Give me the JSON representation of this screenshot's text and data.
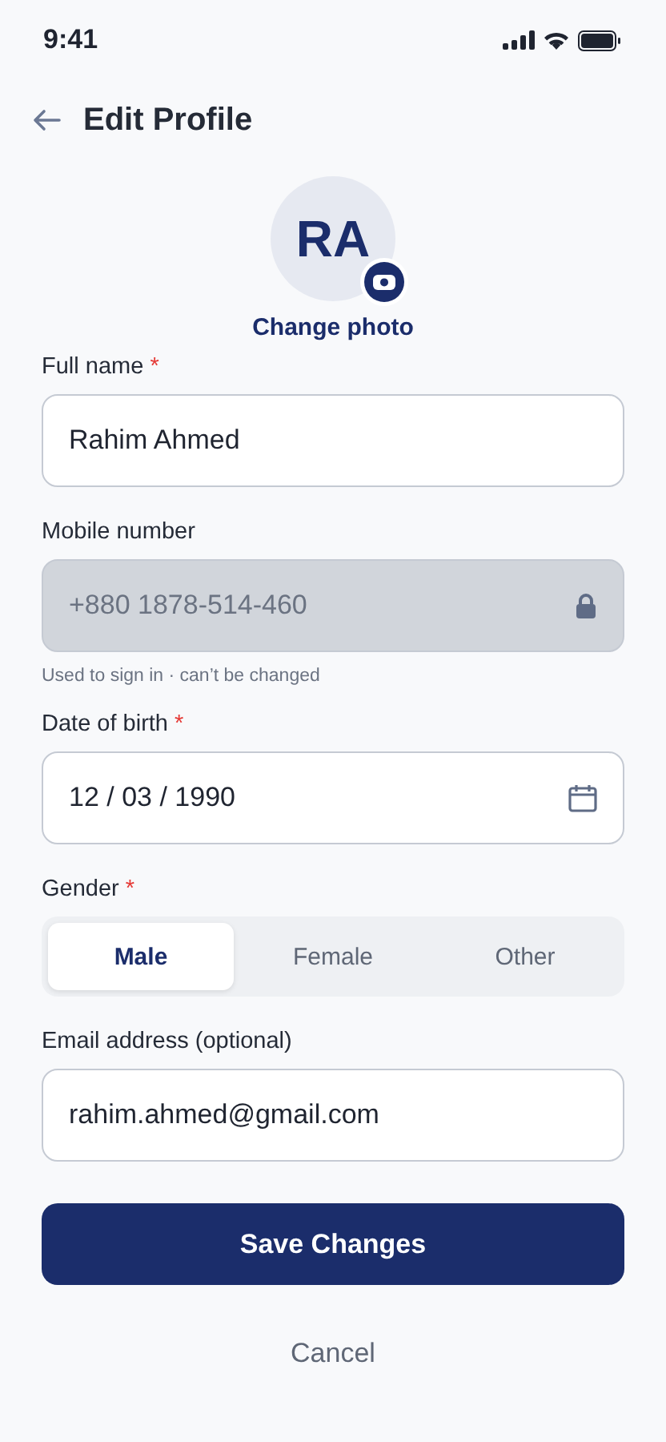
{
  "status_bar": {
    "time": "9:41"
  },
  "header": {
    "title": "Edit Profile"
  },
  "avatar": {
    "initials": "RA",
    "action": "Change photo"
  },
  "fields": [
    {
      "kind": "text",
      "label": "Full name",
      "required_mark": "*",
      "value": "Rahim Ahmed"
    },
    {
      "kind": "locked",
      "label": "Mobile number",
      "value": "+880 1878-514-460",
      "hint": "Used to sign in · can’t be changed"
    },
    {
      "kind": "date",
      "label": "Date of birth",
      "required_mark": "*",
      "value": "12 / 03 / 1990"
    },
    {
      "kind": "segmented",
      "label": "Gender",
      "required_mark": "*",
      "options": [
        {
          "label": "Male",
          "selected": true
        },
        {
          "label": "Female",
          "selected": false
        },
        {
          "label": "Other",
          "selected": false
        }
      ]
    },
    {
      "kind": "text",
      "label": "Email address (optional)",
      "value": "rahim.ahmed@gmail.com"
    }
  ],
  "buttons": {
    "primary": "Save Changes",
    "secondary": "Cancel"
  }
}
